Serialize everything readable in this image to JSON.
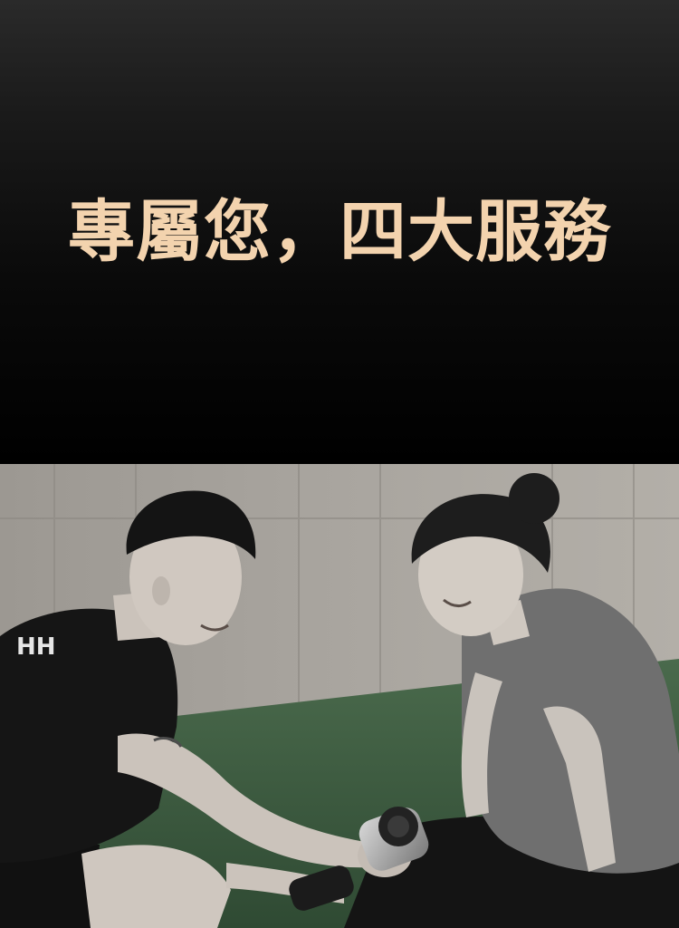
{
  "banner": {
    "headline": "專屬您，四大服務"
  },
  "photo": {
    "subject": "trainer-with-massage-gun-and-client",
    "tone": "monochrome-with-green-turf"
  },
  "colors": {
    "headline": "#f3d3ae",
    "banner_top": "#2a2a2a",
    "banner_bottom": "#000000",
    "turf": "#3d5c40"
  }
}
